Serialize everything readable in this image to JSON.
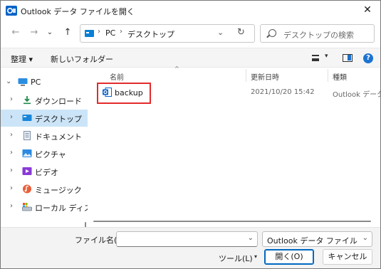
{
  "window": {
    "title": "Outlook データ ファイルを開く",
    "close_glyph": "✕"
  },
  "nav": {
    "back_glyph": "←",
    "forward_glyph": "→",
    "recent_glyph": "⌄",
    "up_glyph": "↑",
    "address": {
      "sep1": "›",
      "pc": "PC",
      "sep2": "›",
      "folder": "デスクトップ",
      "dropdown_glyph": "⌄",
      "refresh_glyph": "↻"
    },
    "search_placeholder": "デスクトップの検索"
  },
  "commandbar": {
    "organize": "整理 ▾",
    "new_folder": "新しいフォルダー",
    "view_caret": "▾",
    "help": "?"
  },
  "tree": [
    {
      "label": "PC",
      "chevron": "⌄",
      "icon": "pc-icon"
    },
    {
      "label": "ダウンロード",
      "chevron": "›",
      "icon": "download-icon"
    },
    {
      "label": "デスクトップ",
      "chevron": "›",
      "icon": "desktop-icon"
    },
    {
      "label": "ドキュメント",
      "chevron": "›",
      "icon": "document-icon"
    },
    {
      "label": "ピクチャ",
      "chevron": "›",
      "icon": "picture-icon"
    },
    {
      "label": "ビデオ",
      "chevron": "›",
      "icon": "video-icon"
    },
    {
      "label": "ミュージック",
      "chevron": "›",
      "icon": "music-icon"
    },
    {
      "label": "ローカル ディスク (",
      "chevron": "›",
      "icon": "disk-icon"
    }
  ],
  "columns": {
    "name": "名前",
    "date": "更新日時",
    "type": "種類",
    "sort_glyph": "^"
  },
  "files": [
    {
      "name": "backup",
      "date": "2021/10/20 15:42",
      "type": "Outlook データ フ",
      "icon": "outlook-file-icon"
    }
  ],
  "bottom": {
    "filename_label": "ファイル名(N):",
    "filename_value": "",
    "filetype_value": "Outlook データ ファイル",
    "dropdown_glyph": "⌄",
    "tools_label": "ツール(L)",
    "tools_caret": "▾",
    "open_label": "開く(O)",
    "cancel_label": "キャンセル"
  },
  "colors": {
    "accent": "#0067c0",
    "selection": "#cce4f7",
    "highlight": "#e32b2b",
    "outlook_blue": "#0a64c8"
  }
}
